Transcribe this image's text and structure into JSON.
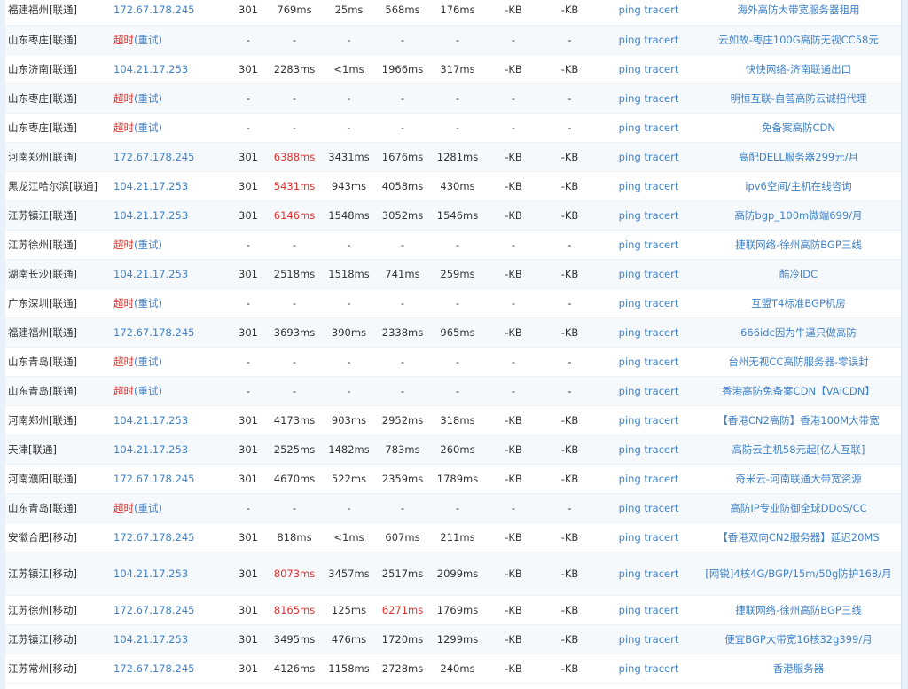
{
  "rows": [
    {
      "loc": "福建福州[联通]",
      "ip": "172.67.178.245",
      "timeout": false,
      "status": "301",
      "total": "769ms",
      "dns": "25ms",
      "connect": "568ms",
      "download": "176ms",
      "size": "-KB",
      "speed": "-KB",
      "ping": "ping",
      "tracert": "tracert",
      "ad": "海外高防大带宽服务器租用",
      "red": []
    },
    {
      "loc": "山东枣庄[联通]",
      "ip": "超时",
      "retry": "(重试)",
      "timeout": true,
      "status": "-",
      "total": "-",
      "dns": "-",
      "connect": "-",
      "download": "-",
      "size": "-",
      "speed": "-",
      "ping": "ping",
      "tracert": "tracert",
      "ad": "云如故-枣庄100G高防无视CC58元",
      "red": []
    },
    {
      "loc": "山东济南[联通]",
      "ip": "104.21.17.253",
      "timeout": false,
      "status": "301",
      "total": "2283ms",
      "dns": "<1ms",
      "connect": "1966ms",
      "download": "317ms",
      "size": "-KB",
      "speed": "-KB",
      "ping": "ping",
      "tracert": "tracert",
      "ad": "快快网络-济南联通出口",
      "red": []
    },
    {
      "loc": "山东枣庄[联通]",
      "ip": "超时",
      "retry": "(重试)",
      "timeout": true,
      "status": "-",
      "total": "-",
      "dns": "-",
      "connect": "-",
      "download": "-",
      "size": "-",
      "speed": "-",
      "ping": "ping",
      "tracert": "tracert",
      "ad": "明恒互联-自营高防云诚招代理",
      "red": []
    },
    {
      "loc": "山东枣庄[联通]",
      "ip": "超时",
      "retry": "(重试)",
      "timeout": true,
      "status": "-",
      "total": "-",
      "dns": "-",
      "connect": "-",
      "download": "-",
      "size": "-",
      "speed": "-",
      "ping": "ping",
      "tracert": "tracert",
      "ad": "免备案高防CDN",
      "red": []
    },
    {
      "loc": "河南郑州[联通]",
      "ip": "172.67.178.245",
      "timeout": false,
      "status": "301",
      "total": "6388ms",
      "dns": "3431ms",
      "connect": "1676ms",
      "download": "1281ms",
      "size": "-KB",
      "speed": "-KB",
      "ping": "ping",
      "tracert": "tracert",
      "ad": "高配DELL服务器299元/月",
      "red": [
        "total"
      ]
    },
    {
      "loc": "黑龙江哈尔滨[联通]",
      "ip": "104.21.17.253",
      "timeout": false,
      "status": "301",
      "total": "5431ms",
      "dns": "943ms",
      "connect": "4058ms",
      "download": "430ms",
      "size": "-KB",
      "speed": "-KB",
      "ping": "ping",
      "tracert": "tracert",
      "ad": "ipv6空间/主机在线咨询",
      "red": [
        "total"
      ]
    },
    {
      "loc": "江苏镇江[联通]",
      "ip": "104.21.17.253",
      "timeout": false,
      "status": "301",
      "total": "6146ms",
      "dns": "1548ms",
      "connect": "3052ms",
      "download": "1546ms",
      "size": "-KB",
      "speed": "-KB",
      "ping": "ping",
      "tracert": "tracert",
      "ad": "高防bgp_100m微端699/月",
      "red": [
        "total"
      ]
    },
    {
      "loc": "江苏徐州[联通]",
      "ip": "超时",
      "retry": "(重试)",
      "timeout": true,
      "status": "-",
      "total": "-",
      "dns": "-",
      "connect": "-",
      "download": "-",
      "size": "-",
      "speed": "-",
      "ping": "ping",
      "tracert": "tracert",
      "ad": "捷联网络-徐州高防BGP三线",
      "red": []
    },
    {
      "loc": "湖南长沙[联通]",
      "ip": "104.21.17.253",
      "timeout": false,
      "status": "301",
      "total": "2518ms",
      "dns": "1518ms",
      "connect": "741ms",
      "download": "259ms",
      "size": "-KB",
      "speed": "-KB",
      "ping": "ping",
      "tracert": "tracert",
      "ad": "酷冷IDC",
      "red": []
    },
    {
      "loc": "广东深圳[联通]",
      "ip": "超时",
      "retry": "(重试)",
      "timeout": true,
      "status": "-",
      "total": "-",
      "dns": "-",
      "connect": "-",
      "download": "-",
      "size": "-",
      "speed": "-",
      "ping": "ping",
      "tracert": "tracert",
      "ad": "互盟T4标准BGP机房",
      "red": []
    },
    {
      "loc": "福建福州[联通]",
      "ip": "172.67.178.245",
      "timeout": false,
      "status": "301",
      "total": "3693ms",
      "dns": "390ms",
      "connect": "2338ms",
      "download": "965ms",
      "size": "-KB",
      "speed": "-KB",
      "ping": "ping",
      "tracert": "tracert",
      "ad": "666idc因为牛逼只做高防",
      "red": []
    },
    {
      "loc": "山东青岛[联通]",
      "ip": "超时",
      "retry": "(重试)",
      "timeout": true,
      "status": "-",
      "total": "-",
      "dns": "-",
      "connect": "-",
      "download": "-",
      "size": "-",
      "speed": "-",
      "ping": "ping",
      "tracert": "tracert",
      "ad": "台州无视CC高防服务器-零误封",
      "red": []
    },
    {
      "loc": "山东青岛[联通]",
      "ip": "超时",
      "retry": "(重试)",
      "timeout": true,
      "status": "-",
      "total": "-",
      "dns": "-",
      "connect": "-",
      "download": "-",
      "size": "-",
      "speed": "-",
      "ping": "ping",
      "tracert": "tracert",
      "ad": "香港高防免备案CDN【VAiCDN】",
      "red": []
    },
    {
      "loc": "河南郑州[联通]",
      "ip": "104.21.17.253",
      "timeout": false,
      "status": "301",
      "total": "4173ms",
      "dns": "903ms",
      "connect": "2952ms",
      "download": "318ms",
      "size": "-KB",
      "speed": "-KB",
      "ping": "ping",
      "tracert": "tracert",
      "ad": "【香港CN2高防】香港100M大带宽",
      "red": []
    },
    {
      "loc": "天津[联通]",
      "ip": "104.21.17.253",
      "timeout": false,
      "status": "301",
      "total": "2525ms",
      "dns": "1482ms",
      "connect": "783ms",
      "download": "260ms",
      "size": "-KB",
      "speed": "-KB",
      "ping": "ping",
      "tracert": "tracert",
      "ad": "高防云主机58元起[亿人互联]",
      "red": []
    },
    {
      "loc": "河南濮阳[联通]",
      "ip": "172.67.178.245",
      "timeout": false,
      "status": "301",
      "total": "4670ms",
      "dns": "522ms",
      "connect": "2359ms",
      "download": "1789ms",
      "size": "-KB",
      "speed": "-KB",
      "ping": "ping",
      "tracert": "tracert",
      "ad": "奇米云-河南联通大带宽资源",
      "red": []
    },
    {
      "loc": "山东青岛[联通]",
      "ip": "超时",
      "retry": "(重试)",
      "timeout": true,
      "status": "-",
      "total": "-",
      "dns": "-",
      "connect": "-",
      "download": "-",
      "size": "-",
      "speed": "-",
      "ping": "ping",
      "tracert": "tracert",
      "ad": "高防IP专业防御全球DDoS/CC",
      "red": []
    },
    {
      "loc": "安徽合肥[移动]",
      "ip": "172.67.178.245",
      "timeout": false,
      "status": "301",
      "total": "818ms",
      "dns": "<1ms",
      "connect": "607ms",
      "download": "211ms",
      "size": "-KB",
      "speed": "-KB",
      "ping": "ping",
      "tracert": "tracert",
      "ad": "【香港双向CN2服务器】延迟20MS",
      "red": []
    },
    {
      "loc": "江苏镇江[移动]",
      "ip": "104.21.17.253",
      "timeout": false,
      "status": "301",
      "total": "8073ms",
      "dns": "3457ms",
      "connect": "2517ms",
      "download": "2099ms",
      "size": "-KB",
      "speed": "-KB",
      "ping": "ping",
      "tracert": "tracert",
      "ad": "[网锐]4核4G/BGP/15m/50g防护168/月",
      "red": [
        "total"
      ],
      "tall": true
    },
    {
      "loc": "江苏徐州[移动]",
      "ip": "172.67.178.245",
      "timeout": false,
      "status": "301",
      "total": "8165ms",
      "dns": "125ms",
      "connect": "6271ms",
      "download": "1769ms",
      "size": "-KB",
      "speed": "-KB",
      "ping": "ping",
      "tracert": "tracert",
      "ad": "捷联网络-徐州高防BGP三线",
      "red": [
        "total",
        "connect"
      ]
    },
    {
      "loc": "江苏镇江[移动]",
      "ip": "104.21.17.253",
      "timeout": false,
      "status": "301",
      "total": "3495ms",
      "dns": "476ms",
      "connect": "1720ms",
      "download": "1299ms",
      "size": "-KB",
      "speed": "-KB",
      "ping": "ping",
      "tracert": "tracert",
      "ad": "便宜BGP大带宽16核32g399/月",
      "red": []
    },
    {
      "loc": "江苏常州[移动]",
      "ip": "172.67.178.245",
      "timeout": false,
      "status": "301",
      "total": "4126ms",
      "dns": "1158ms",
      "connect": "2728ms",
      "download": "240ms",
      "size": "-KB",
      "speed": "-KB",
      "ping": "ping",
      "tracert": "tracert",
      "ad": "香港服务器",
      "red": []
    }
  ]
}
